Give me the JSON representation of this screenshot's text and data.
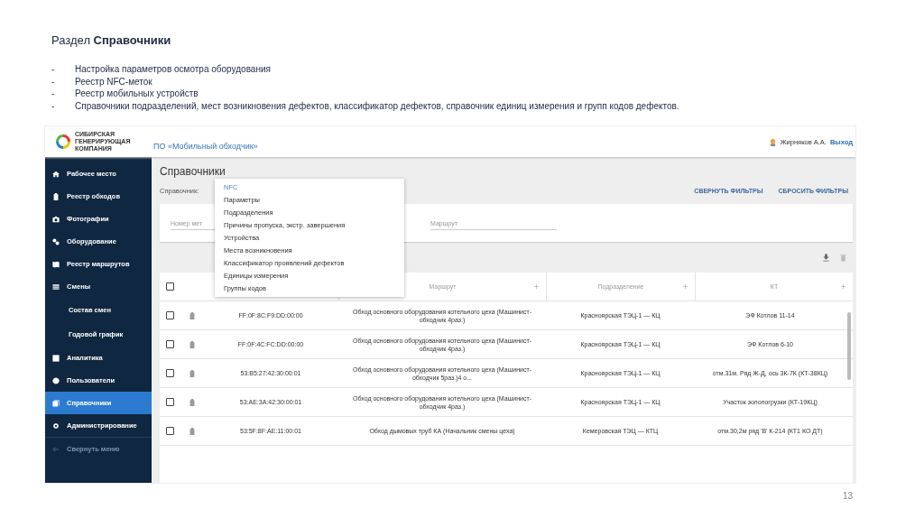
{
  "slide": {
    "title": "Раздел **Справочники**",
    "bullets": [
      {
        "marker": "-",
        "text": "Настройка параметров осмотра оборудования"
      },
      {
        "marker": "-",
        "text": "Реестр NFC-меток"
      },
      {
        "marker": "-",
        "text": "Реестр мобильных устройств"
      },
      {
        "marker": "-",
        "text": "Справочники подразделений, мест возникновения дефектов, классификатор дефектов, справочник единиц измерения и групп кодов дефектов."
      }
    ],
    "page_number": "13"
  },
  "app": {
    "logo_text": [
      "СИБИРСКАЯ",
      "ГЕНЕРИРУЮЩАЯ",
      "КОМПАНИЯ"
    ],
    "title": "ПО «Мобильный обходчик»",
    "user": "Жирняков А.А.",
    "logout": "Выход",
    "sidebar": {
      "items": [
        {
          "label": "Рабочее место",
          "selected": false
        },
        {
          "label": "Реестр обходов",
          "selected": false
        },
        {
          "label": "Фотографии",
          "selected": false
        },
        {
          "label": "Оборудование",
          "selected": false
        },
        {
          "label": "Реестр маршрутов",
          "selected": false
        },
        {
          "label": "Смены",
          "selected": false,
          "children": [
            {
              "label": "Состав смен",
              "selected": false
            },
            {
              "label": "Годовой график",
              "selected": false
            }
          ]
        },
        {
          "label": "Аналитика",
          "selected": false
        },
        {
          "label": "Пользователи",
          "selected": false
        },
        {
          "label": "Справочники",
          "selected": true
        },
        {
          "label": "Администрирование",
          "selected": false
        }
      ],
      "collapse": "Свернуть меню"
    },
    "page_title": "Справочники",
    "dictionary_label": "Справочник:",
    "filter_buttons": [
      "СВЕРНУТЬ ФИЛЬТРЫ",
      "СБРОСИТЬ ФИЛЬТРЫ"
    ],
    "filters": [
      {
        "placeholder": "Номер мет"
      },
      {
        "placeholder": "Маршрут"
      }
    ],
    "dropdown": [
      {
        "label": "NFC",
        "selected": true
      },
      {
        "label": "Параметры",
        "selected": false
      },
      {
        "label": "Подразделения",
        "selected": false
      },
      {
        "label": "Причины пропуска, экстр. завершения",
        "selected": false
      },
      {
        "label": "Устройства",
        "selected": false
      },
      {
        "label": "Места возникновения",
        "selected": false
      },
      {
        "label": "Классификатор проявлений дефектов",
        "selected": false
      },
      {
        "label": "Единицы измерения",
        "selected": false
      },
      {
        "label": "Группы кодов",
        "selected": false
      }
    ],
    "table": {
      "columns": [
        "Маршрут",
        "Подразделение",
        "КТ"
      ],
      "all_checked": false,
      "rows": [
        {
          "checked": false,
          "tag": "FF:0F:8C:F9:DD:00:00",
          "route": "Обход основного оборудования котельного цеха (Машинист-обходчик 4раз.)",
          "unit": "Красноярская ТЭЦ-1 — КЦ",
          "kt": "ЭФ Котлов 11-14"
        },
        {
          "checked": false,
          "tag": "FF:0F:4C:FC:DD:00:00",
          "route": "Обход основного оборудования котельного цеха (Машинист-обходчик 4раз.)",
          "unit": "Красноярская ТЭЦ-1 — КЦ",
          "kt": "ЭФ Котлов 6-10"
        },
        {
          "checked": false,
          "tag": "53:B5:27:42:30:00:01",
          "route": "Обход основного оборудования котельного цеха (Машинист-обходчик 5раз.)4 о...",
          "unit": "Красноярская ТЭЦ-1 — КЦ",
          "kt": "отм.31м. Ряд Ж-Д, ось 3К-7К (КТ-38КЦ)"
        },
        {
          "checked": false,
          "tag": "53:AE:3A:42:30:00:01",
          "route": "Обход основного оборудования котельного цеха (Машинист-обходчик 4раз.)",
          "unit": "Красноярская ТЭЦ-1 — КЦ",
          "kt": "Участок золопогрузки (КТ-19КЦ)"
        },
        {
          "checked": false,
          "tag": "53:5F:8F:AE:11:00:01",
          "route": "Обход дымовых труб КА (Начальник смены цеха)",
          "unit": "Кемеровская ТЭЦ — КТЦ",
          "kt": "отм.30,2м ряд 'В' К-214 (КТ1 КО ДТ)"
        }
      ]
    }
  }
}
